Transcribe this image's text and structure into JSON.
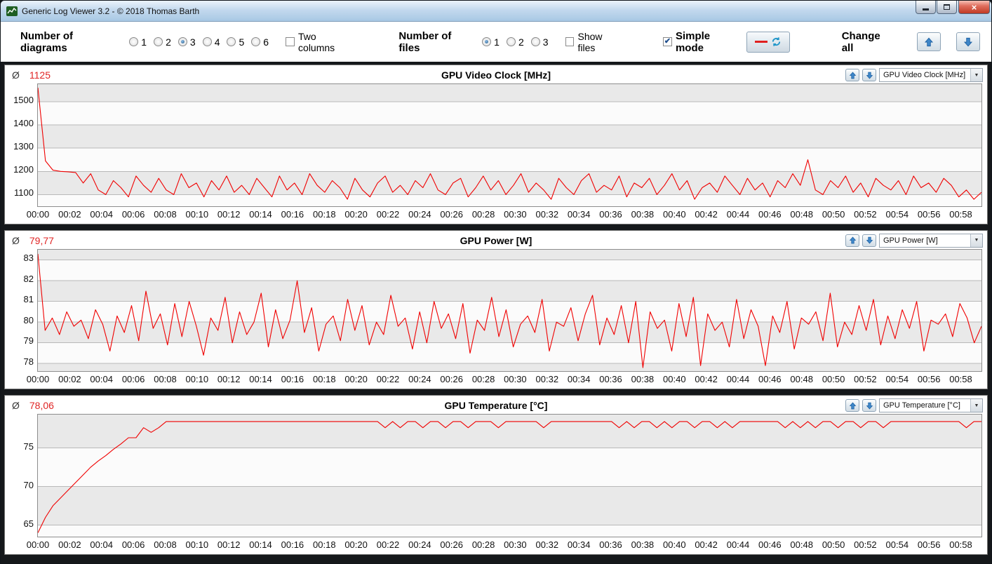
{
  "window": {
    "title": "Generic Log Viewer 3.2 - © 2018 Thomas Barth"
  },
  "icons": {
    "dropdown_arrow": "▼",
    "close": "×",
    "check": "✔"
  },
  "ui": {
    "avg_symbol": "Ø"
  },
  "toolbar": {
    "diagrams_label": "Number of diagrams",
    "diagram_options": [
      "1",
      "2",
      "3",
      "4",
      "5",
      "6"
    ],
    "diagrams_selected": "3",
    "two_columns_label": "Two columns",
    "two_columns_checked": false,
    "files_label": "Number of files",
    "file_options": [
      "1",
      "2",
      "3"
    ],
    "files_selected": "1",
    "show_files_label": "Show files",
    "show_files_checked": false,
    "simple_mode_label": "Simple mode",
    "simple_mode_checked": true,
    "change_all_label": "Change all"
  },
  "chart_data": [
    {
      "type": "line",
      "title": "GPU Video Clock [MHz]",
      "average_value": "1125",
      "dropdown_value": "GPU Video Clock [MHz]",
      "color": "#f00000",
      "ylim": [
        1050,
        1575
      ],
      "ytick_values": [
        1100,
        1200,
        1300,
        1400,
        1500
      ],
      "ytick_labels": [
        "1100",
        "1200",
        "1300",
        "1400",
        "1500"
      ],
      "x_end_minutes": 59.3,
      "xtick_labels": [
        "00:00",
        "00:02",
        "00:04",
        "00:06",
        "00:08",
        "00:10",
        "00:12",
        "00:14",
        "00:16",
        "00:18",
        "00:20",
        "00:22",
        "00:24",
        "00:26",
        "00:28",
        "00:30",
        "00:32",
        "00:34",
        "00:36",
        "00:38",
        "00:40",
        "00:42",
        "00:44",
        "00:46",
        "00:48",
        "00:50",
        "00:52",
        "00:54",
        "00:56",
        "00:58"
      ],
      "values": [
        1560,
        1245,
        1205,
        1200,
        1198,
        1195,
        1150,
        1190,
        1120,
        1100,
        1160,
        1130,
        1090,
        1180,
        1140,
        1110,
        1170,
        1120,
        1100,
        1190,
        1130,
        1150,
        1090,
        1160,
        1120,
        1180,
        1110,
        1140,
        1100,
        1170,
        1130,
        1090,
        1180,
        1120,
        1150,
        1100,
        1190,
        1140,
        1110,
        1160,
        1130,
        1080,
        1170,
        1120,
        1090,
        1150,
        1180,
        1110,
        1140,
        1100,
        1160,
        1130,
        1190,
        1120,
        1100,
        1150,
        1170,
        1090,
        1130,
        1180,
        1120,
        1160,
        1100,
        1140,
        1190,
        1110,
        1150,
        1120,
        1080,
        1170,
        1130,
        1100,
        1160,
        1190,
        1110,
        1140,
        1120,
        1180,
        1090,
        1150,
        1130,
        1170,
        1100,
        1140,
        1190,
        1120,
        1160,
        1080,
        1130,
        1150,
        1110,
        1180,
        1140,
        1100,
        1170,
        1120,
        1150,
        1090,
        1160,
        1130,
        1190,
        1140,
        1250,
        1120,
        1100,
        1160,
        1130,
        1180,
        1110,
        1150,
        1090,
        1170,
        1140,
        1120,
        1160,
        1100,
        1180,
        1130,
        1150,
        1110,
        1170,
        1140,
        1090,
        1120,
        1080,
        1110
      ]
    },
    {
      "type": "line",
      "title": "GPU Power [W]",
      "average_value": "79,77",
      "dropdown_value": "GPU Power [W]",
      "color": "#f00000",
      "ylim": [
        77.6,
        83.5
      ],
      "ytick_values": [
        78,
        79,
        80,
        81,
        82,
        83
      ],
      "ytick_labels": [
        "78",
        "79",
        "80",
        "81",
        "82",
        "83"
      ],
      "x_end_minutes": 59.3,
      "xtick_labels": [
        "00:00",
        "00:02",
        "00:04",
        "00:06",
        "00:08",
        "00:10",
        "00:12",
        "00:14",
        "00:16",
        "00:18",
        "00:20",
        "00:22",
        "00:24",
        "00:26",
        "00:28",
        "00:30",
        "00:32",
        "00:34",
        "00:36",
        "00:38",
        "00:40",
        "00:42",
        "00:44",
        "00:46",
        "00:48",
        "00:50",
        "00:52",
        "00:54",
        "00:56",
        "00:58"
      ],
      "values": [
        83.3,
        79.6,
        80.2,
        79.4,
        80.5,
        79.8,
        80.1,
        79.2,
        80.6,
        79.9,
        78.6,
        80.3,
        79.5,
        80.8,
        79.1,
        81.5,
        79.7,
        80.4,
        78.9,
        80.9,
        79.3,
        81.0,
        79.8,
        78.4,
        80.2,
        79.6,
        81.2,
        79.0,
        80.5,
        79.4,
        80.0,
        81.4,
        78.8,
        80.6,
        79.2,
        80.1,
        82.0,
        79.5,
        80.7,
        78.6,
        79.9,
        80.3,
        79.1,
        81.1,
        79.6,
        80.8,
        78.9,
        80.0,
        79.4,
        81.3,
        79.8,
        80.2,
        78.7,
        80.5,
        79.0,
        81.0,
        79.7,
        80.4,
        79.2,
        80.9,
        78.5,
        80.1,
        79.6,
        81.2,
        79.3,
        80.6,
        78.8,
        79.9,
        80.3,
        79.5,
        81.1,
        78.6,
        80.0,
        79.8,
        80.7,
        79.1,
        80.4,
        81.3,
        78.9,
        80.2,
        79.4,
        80.8,
        79.0,
        81.0,
        77.8,
        80.5,
        79.7,
        80.1,
        78.6,
        80.9,
        79.3,
        81.2,
        77.9,
        80.4,
        79.6,
        80.0,
        78.8,
        81.1,
        79.2,
        80.6,
        79.8,
        77.9,
        80.3,
        79.5,
        81.0,
        78.7,
        80.2,
        79.9,
        80.5,
        79.1,
        81.4,
        78.8,
        80.0,
        79.4,
        80.8,
        79.6,
        81.1,
        78.9,
        80.3,
        79.2,
        80.6,
        79.7,
        81.0,
        78.6,
        80.1,
        79.9,
        80.4,
        79.3,
        80.9,
        80.2,
        79.0,
        79.8
      ]
    },
    {
      "type": "line",
      "title": "GPU Temperature [°C]",
      "average_value": "78,06",
      "dropdown_value": "GPU Temperature [°C]",
      "color": "#f00000",
      "ylim": [
        63.5,
        79.3
      ],
      "ytick_values": [
        65,
        70,
        75
      ],
      "ytick_labels": [
        "65",
        "70",
        "75"
      ],
      "x_end_minutes": 59.3,
      "xtick_labels": [
        "00:00",
        "00:02",
        "00:04",
        "00:06",
        "00:08",
        "00:10",
        "00:12",
        "00:14",
        "00:16",
        "00:18",
        "00:20",
        "00:22",
        "00:24",
        "00:26",
        "00:28",
        "00:30",
        "00:32",
        "00:34",
        "00:36",
        "00:38",
        "00:40",
        "00:42",
        "00:44",
        "00:46",
        "00:48",
        "00:50",
        "00:52",
        "00:54",
        "00:56",
        "00:58"
      ],
      "values": [
        64.0,
        66.0,
        67.5,
        68.5,
        69.5,
        70.5,
        71.5,
        72.5,
        73.3,
        74.0,
        74.8,
        75.5,
        76.3,
        76.3,
        77.6,
        77.0,
        77.6,
        78.4,
        78.4,
        78.4,
        78.4,
        78.4,
        78.4,
        78.4,
        78.4,
        78.4,
        78.4,
        78.4,
        78.4,
        78.4,
        78.4,
        78.4,
        78.4,
        78.4,
        78.4,
        78.4,
        78.4,
        78.4,
        78.4,
        78.4,
        78.4,
        78.4,
        78.4,
        78.4,
        78.4,
        78.4,
        77.6,
        78.4,
        77.6,
        78.4,
        78.4,
        77.6,
        78.4,
        78.4,
        77.6,
        78.4,
        78.4,
        77.6,
        78.4,
        78.4,
        78.4,
        77.6,
        78.4,
        78.4,
        78.4,
        78.4,
        78.4,
        77.6,
        78.4,
        78.4,
        78.4,
        78.4,
        78.4,
        78.4,
        78.4,
        78.4,
        78.4,
        77.6,
        78.4,
        77.6,
        78.4,
        78.4,
        77.6,
        78.4,
        77.6,
        78.4,
        78.4,
        77.6,
        78.4,
        78.4,
        77.6,
        78.4,
        77.6,
        78.4,
        78.4,
        78.4,
        78.4,
        78.4,
        78.4,
        77.6,
        78.4,
        77.6,
        78.4,
        77.6,
        78.4,
        78.4,
        77.6,
        78.4,
        78.4,
        77.6,
        78.4,
        78.4,
        77.6,
        78.4,
        78.4,
        78.4,
        78.4,
        78.4,
        78.4,
        78.4,
        78.4,
        78.4,
        78.4,
        77.6,
        78.4,
        78.4
      ]
    }
  ]
}
